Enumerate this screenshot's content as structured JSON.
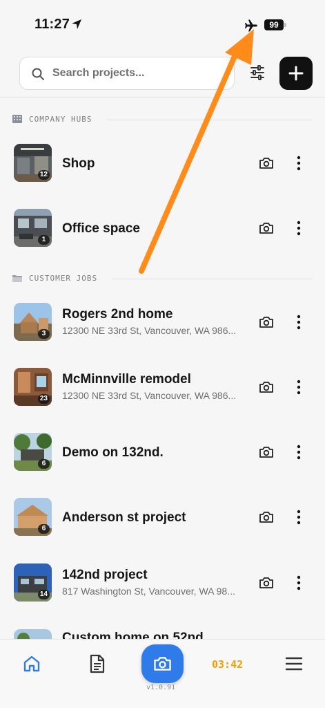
{
  "status_bar": {
    "time": "11:27",
    "battery": "99"
  },
  "search": {
    "placeholder": "Search projects..."
  },
  "sections": {
    "company_hubs": "COMPANY HUBS",
    "customer_jobs": "CUSTOMER JOBS"
  },
  "company_hubs": [
    {
      "title": "Shop",
      "count": "12"
    },
    {
      "title": "Office space",
      "count": "1"
    }
  ],
  "customer_jobs": [
    {
      "title": "Rogers 2nd home",
      "address": "12300 NE 33rd St, Vancouver, WA 986...",
      "count": "3"
    },
    {
      "title": "McMinnville remodel",
      "address": "12300 NE 33rd St, Vancouver, WA 986...",
      "count": "23"
    },
    {
      "title": "Demo on 132nd.",
      "address": "",
      "count": "6"
    },
    {
      "title": "Anderson st project",
      "address": "",
      "count": "6"
    },
    {
      "title": "142nd project",
      "address": "817 Washington St, Vancouver, WA 98...",
      "count": "14"
    },
    {
      "title": "Custom home on 52nd",
      "address": "",
      "count": ""
    }
  ],
  "tab_bar": {
    "timer": "03:42",
    "version": "v1.0.91"
  },
  "colors": {
    "accent": "#2f7bea",
    "timer": "#f0a000",
    "annotation": "#ff8c1a"
  }
}
